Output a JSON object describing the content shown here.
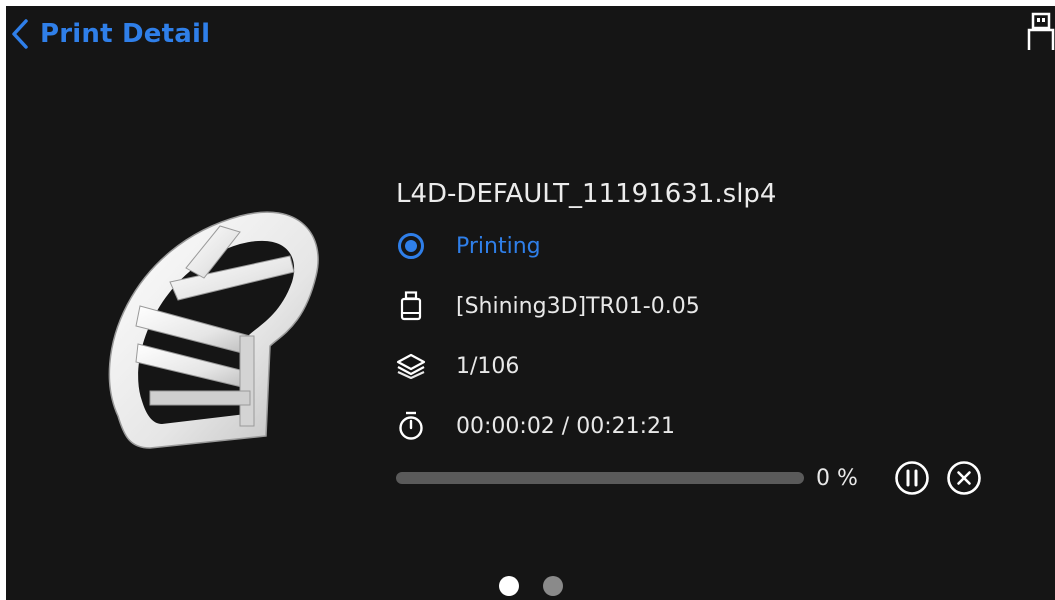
{
  "header": {
    "title": "Print Detail",
    "back_icon": "chevron-left-icon",
    "usb_icon": "usb-drive-icon"
  },
  "job": {
    "file_name": "L4D-DEFAULT_11191631.slp4",
    "status": "Printing",
    "resin": "[Shining3D]TR01-0.05",
    "layers": "1/106",
    "time": "00:00:02 / 00:21:21",
    "progress_label": "0 %",
    "progress_fraction": 0
  },
  "controls": {
    "pause_icon": "pause-circle-icon",
    "cancel_icon": "close-circle-icon"
  },
  "pager": {
    "pages": 2,
    "current": 1
  },
  "colors": {
    "accent": "#2f7fe9",
    "background": "#151515",
    "text": "#e8e8e8"
  }
}
